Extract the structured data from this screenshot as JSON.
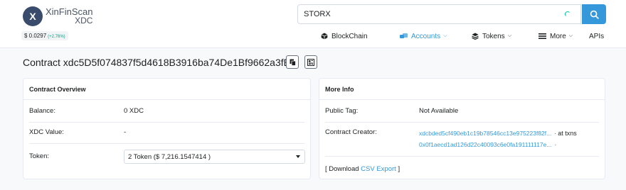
{
  "header": {
    "logo_letter": "X",
    "logo_name": "XinFinScan",
    "logo_sub": "XDC",
    "price": "$ 0.0297",
    "price_change": "(+2.76%)",
    "search_value": "STORX"
  },
  "nav": {
    "blockchain": "BlockChain",
    "accounts": "Accounts",
    "tokens": "Tokens",
    "more": "More",
    "apis": "APIs"
  },
  "page": {
    "title": "Contract xdc5D5f074837f5d4618B3916ba74De1Bf9662a3fEd"
  },
  "overview": {
    "header": "Contract Overview",
    "balance_label": "Balance:",
    "balance_value": "0 XDC",
    "xdc_value_label": "XDC Value:",
    "xdc_value": "-",
    "token_label": "Token:",
    "token_selected": "2 Token ($ 7,216.1547414 )"
  },
  "more_info": {
    "header": "More Info",
    "public_tag_label": "Public Tag:",
    "public_tag_value": "Not Available",
    "creator_label": "Contract Creator:",
    "creator_address": "xdcbded5cf490eb1c19b78546cc13e975223f82f...",
    "creator_at_txns": "at txns",
    "creator_tx": "0x0f1aecd1ad126d22c40093c6e0fa191111117e...",
    "download_prefix": "[ Download",
    "download_link": "CSV Export",
    "download_suffix": "]"
  },
  "colors": {
    "accent": "#3498db",
    "positive": "#00a186",
    "logo": "#3a4c6b"
  }
}
